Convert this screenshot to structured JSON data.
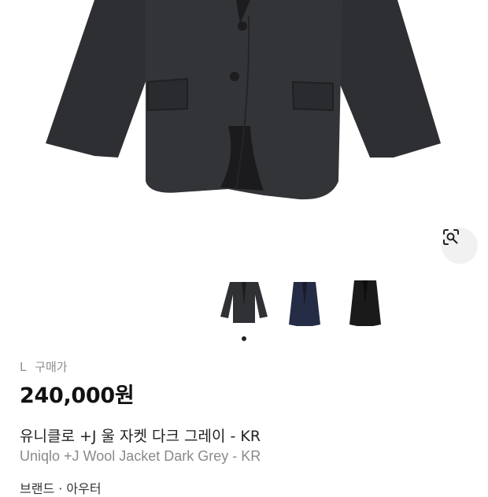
{
  "product": {
    "size": "L",
    "type_label": "구매가",
    "price": "240,000원",
    "name_ko": "유니클로 +J 울 자켓 다크 그레이 - KR",
    "name_en": "Uniqlo +J Wool Jacket Dark Grey - KR",
    "next_section": "브랜드 · 아우터"
  },
  "gallery": {
    "active_index": 0,
    "thumbnails": [
      {
        "color": "#2f3134",
        "name": "dark-grey"
      },
      {
        "color": "#252c45",
        "name": "navy"
      },
      {
        "color": "#1a1a1a",
        "name": "black"
      }
    ]
  },
  "icons": {
    "lens": "lens-search-icon"
  }
}
